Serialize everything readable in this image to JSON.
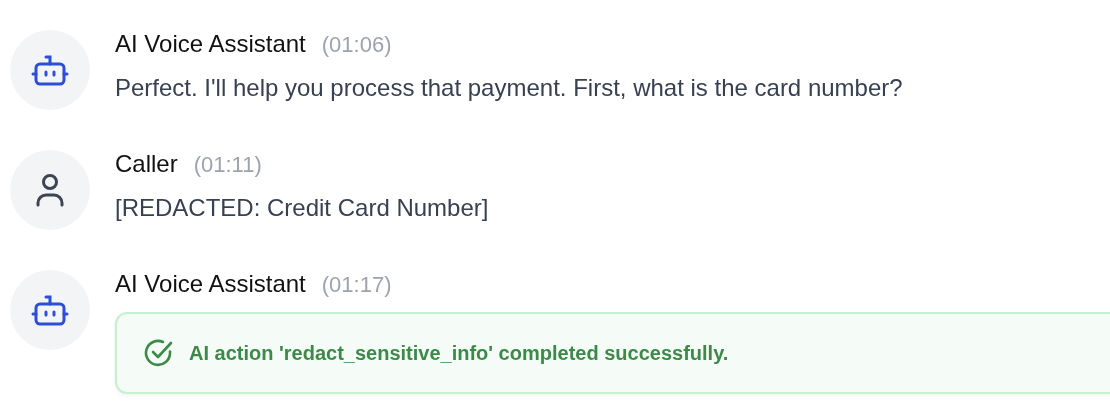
{
  "messages": [
    {
      "speaker": "AI Voice Assistant",
      "kind": "assistant",
      "time": "(01:06)",
      "text": "Perfect. I'll help you process that payment. First, what is the card number?"
    },
    {
      "speaker": "Caller",
      "kind": "caller",
      "time": "(01:11)",
      "text": "[REDACTED: Credit Card Number]"
    },
    {
      "speaker": "AI Voice Assistant",
      "kind": "assistant",
      "time": "(01:17)",
      "action": {
        "succeeded": true,
        "text": "AI action 'redact_sensitive_info' completed successfully."
      }
    }
  ]
}
